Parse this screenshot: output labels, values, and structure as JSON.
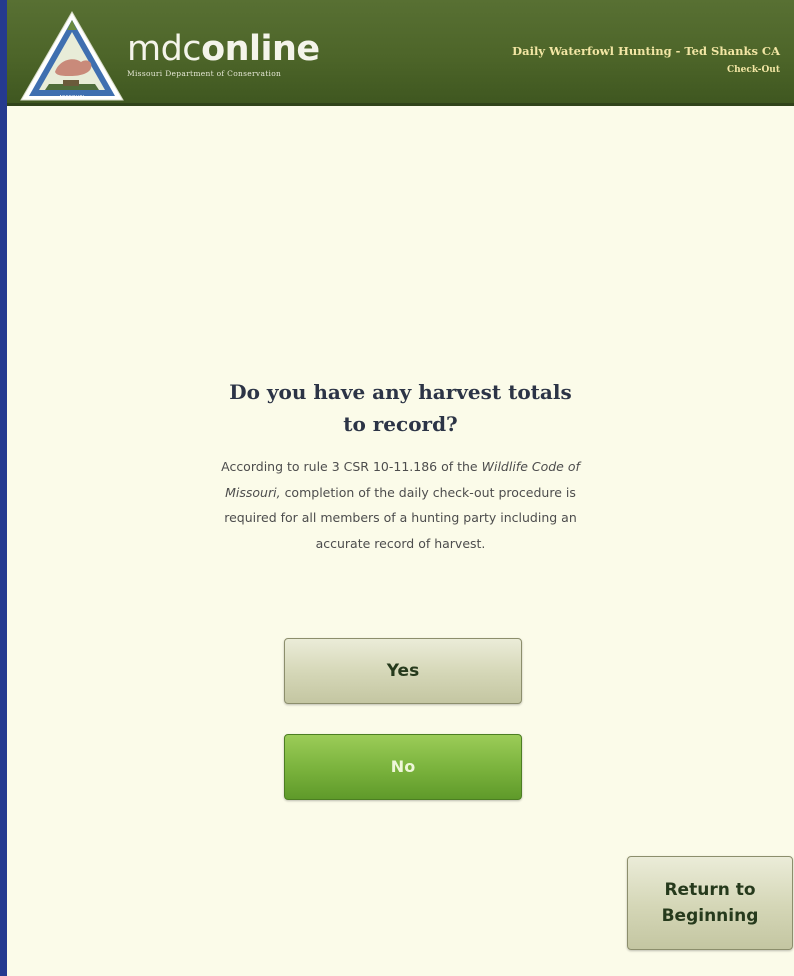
{
  "header": {
    "brand_light": "mdc",
    "brand_bold": "online",
    "brand_sub": "Missouri Department of Conservation",
    "title": "Daily Waterfowl Hunting - Ted Shanks CA",
    "subtitle": "Check-Out",
    "logo_icon": "mdc-triangle-logo-icon"
  },
  "question": {
    "title": "Do you have any harvest totals to record?",
    "body_prefix": "According to rule 3 CSR 10-11.186 of the",
    "body_italic": "Wildlife Code of Missouri,",
    "body_suffix": "completion of the daily check-out procedure is required for all members of a hunting party including an accurate record of harvest."
  },
  "buttons": {
    "yes_label": "Yes",
    "no_label": "No",
    "return_line1": "Return to",
    "return_line2": "Beginning"
  },
  "colors": {
    "header_green": "#4d6529",
    "header_text_gold": "#f2e6a4",
    "page_background": "#fbfbe9",
    "no_button_green": "#7cb43e",
    "neutral_button": "#d4d6b6",
    "frame_blue": "#28378c"
  }
}
